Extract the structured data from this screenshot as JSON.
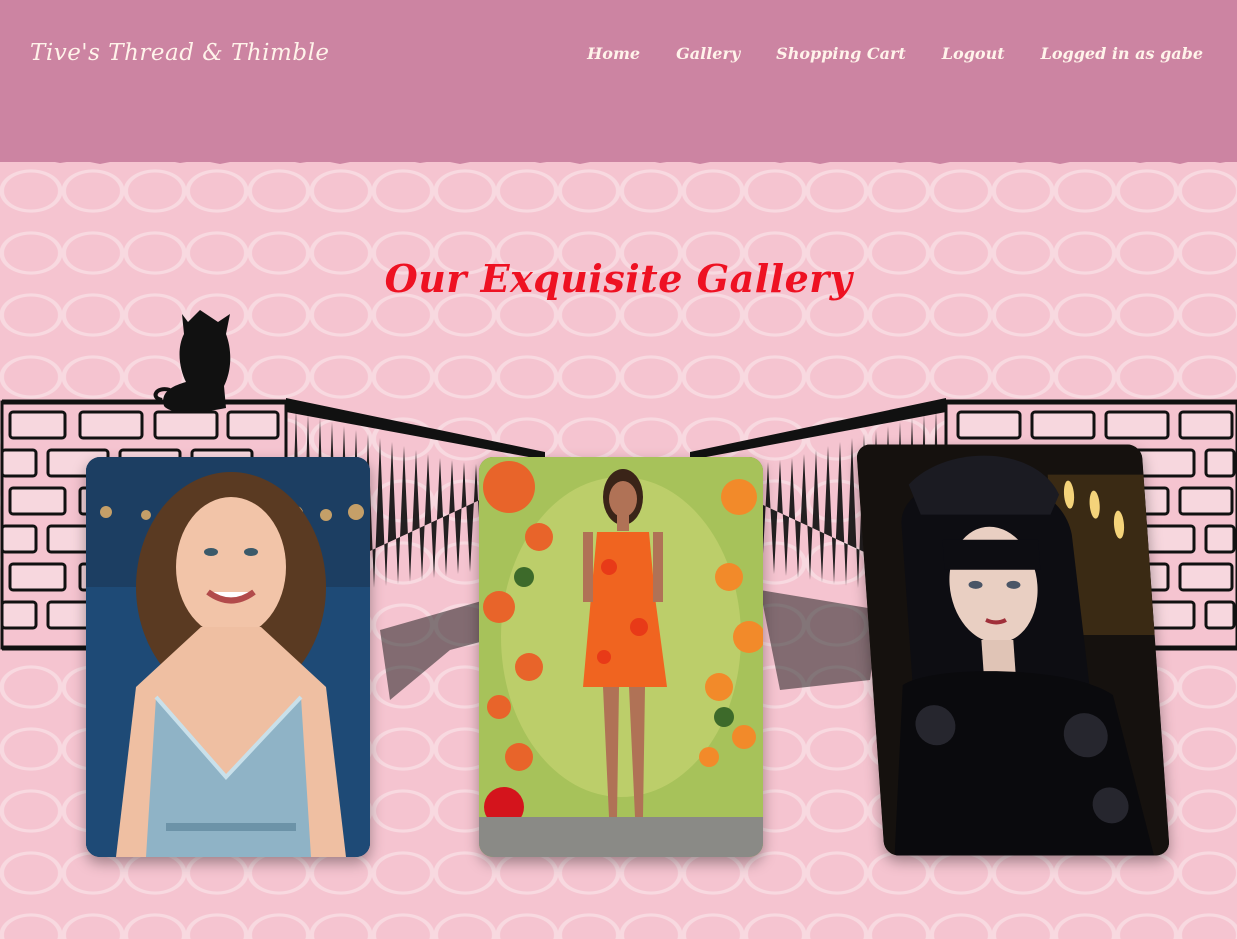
{
  "header": {
    "brand": "Tive's Thread & Thimble",
    "nav": [
      {
        "label": "Home"
      },
      {
        "label": "Gallery"
      },
      {
        "label": "Shopping Cart"
      },
      {
        "label": "Logout"
      }
    ],
    "user_status": "Logged in as gabe"
  },
  "main": {
    "title": "Our Exquisite Gallery"
  },
  "gallery": {
    "items": [
      {
        "name": "woman in light blue satin dress"
      },
      {
        "name": "woman in orange floral dress"
      },
      {
        "name": "woman in black gothic lace dress"
      }
    ]
  },
  "colors": {
    "header_bg": "#cc84a2",
    "page_bg": "#f5c4d0",
    "title": "#ee1122",
    "nav_text": "#fff3ea"
  }
}
